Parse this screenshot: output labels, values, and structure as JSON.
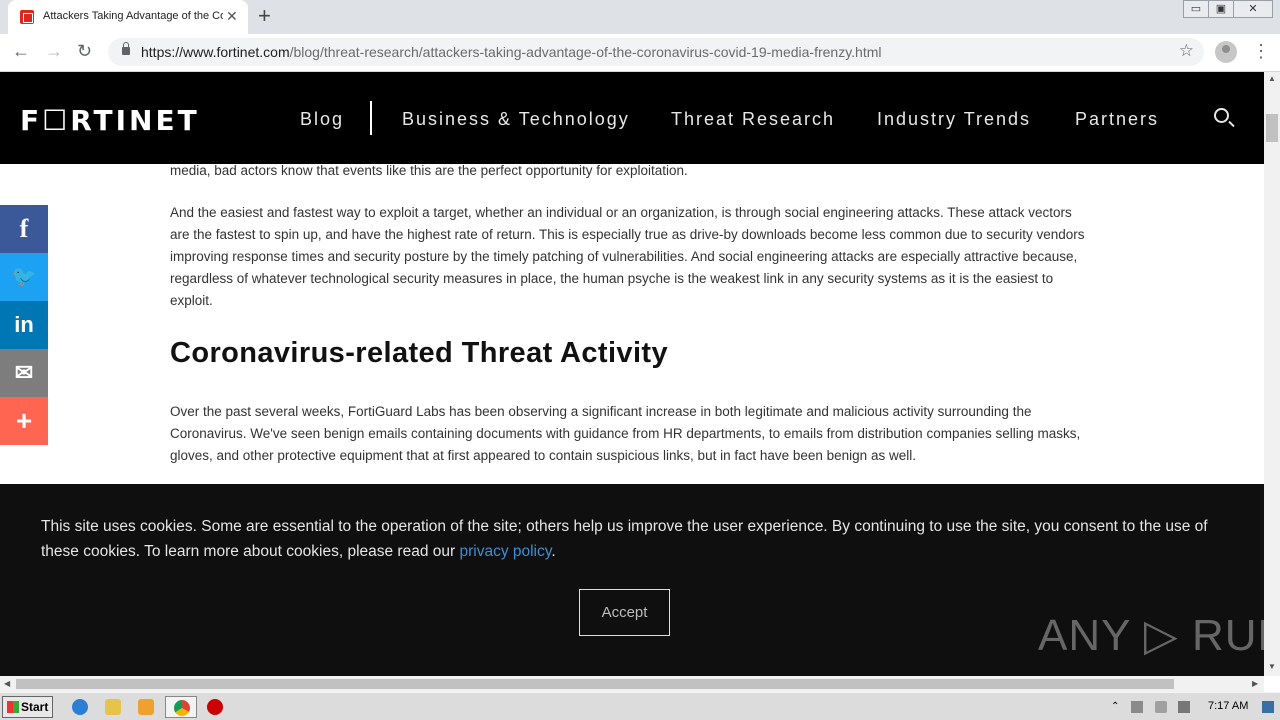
{
  "browser": {
    "tab_title": "Attackers Taking Advantage of the Coronavirus",
    "tab_close": "✕",
    "new_tab": "+",
    "url_host": "https://www.fortinet.com",
    "url_path": "/blog/threat-research/attackers-taking-advantage-of-the-coronavirus-covid-19-media-frenzy.html",
    "window_controls": [
      "▭",
      "▣",
      "✕"
    ]
  },
  "site": {
    "logo": "F☐RTINET",
    "nav": [
      "Blog",
      "Business & Technology",
      "Threat Research",
      "Industry Trends",
      "Partners"
    ]
  },
  "article": {
    "p0": "media, bad actors know that events like this are the perfect opportunity for exploitation.",
    "p1": "And the easiest and fastest way to exploit a target, whether an individual or an organization, is through social engineering attacks. These attack vectors are the fastest to spin up, and have the highest rate of return. This is especially true as drive-by downloads become less common due to security vendors improving response times and security posture by the timely patching of vulnerabilities. And social engineering attacks are especially attractive because, regardless of whatever technological security measures in place, the human psyche is the weakest link in any security systems as it is the easiest to exploit.",
    "heading": "Coronavirus-related Threat Activity",
    "p2": "Over the past several weeks, FortiGuard Labs has been observing a significant increase in both legitimate and malicious activity surrounding the Coronavirus. We've seen benign emails containing documents with guidance from HR departments, to emails from distribution companies selling masks, gloves, and other protective equipment that at first appeared to contain suspicious links, but in fact have been benign as well."
  },
  "share": [
    {
      "icon": "facebook-icon",
      "glyph": "f",
      "color": "#3b5998"
    },
    {
      "icon": "twitter-icon",
      "glyph": "🐦",
      "color": "#1da1f2"
    },
    {
      "icon": "linkedin-icon",
      "glyph": "in",
      "color": "#0077b5"
    },
    {
      "icon": "email-icon",
      "glyph": "✉",
      "color": "#7d7d7d"
    },
    {
      "icon": "plus-icon",
      "glyph": "+",
      "color": "#ff6550"
    }
  ],
  "cookie": {
    "text": "This site uses cookies. Some are essential to the operation of the site; others help us improve the user experience. By continuing to use the site, you consent to the use of these cookies. To learn more about cookies, please read our ",
    "link": "privacy policy",
    "tail": ".",
    "accept": "Accept",
    "watermark": "ANY ▷ RUN"
  },
  "taskbar": {
    "start": "Start",
    "clock": "7:17 AM"
  }
}
